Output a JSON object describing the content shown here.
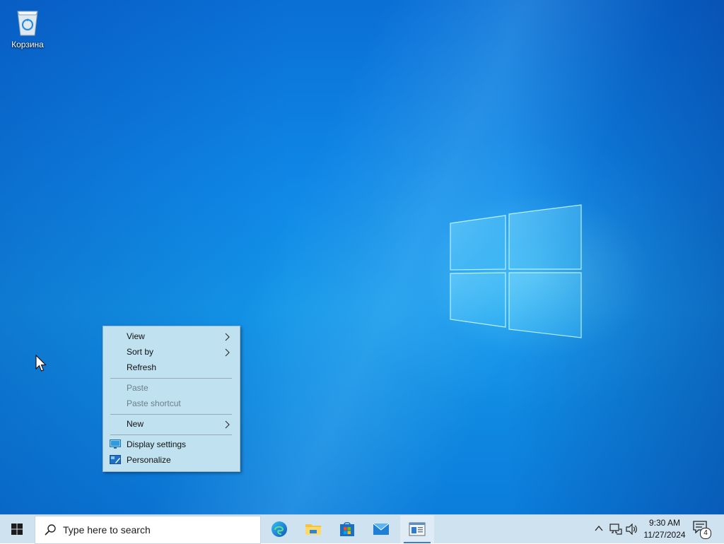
{
  "desktop": {
    "icons": [
      {
        "label": "Корзина",
        "icon": "recycle-bin-icon"
      }
    ]
  },
  "context_menu": {
    "items": [
      {
        "label": "View",
        "submenu": true,
        "enabled": true
      },
      {
        "label": "Sort by",
        "submenu": true,
        "enabled": true
      },
      {
        "label": "Refresh",
        "submenu": false,
        "enabled": true
      },
      {
        "label": "Paste",
        "submenu": false,
        "enabled": false
      },
      {
        "label": "Paste shortcut",
        "submenu": false,
        "enabled": false
      },
      {
        "label": "New",
        "submenu": true,
        "enabled": true
      },
      {
        "label": "Display settings",
        "icon": "display-settings-icon",
        "enabled": true
      },
      {
        "label": "Personalize",
        "icon": "personalize-icon",
        "enabled": true
      }
    ]
  },
  "taskbar": {
    "search_placeholder": "Type here to search",
    "pinned_apps": [
      "edge-icon",
      "file-explorer-icon",
      "microsoft-store-icon",
      "mail-icon",
      "notepad-app-icon"
    ],
    "tray_icons": [
      "chevron-up-icon",
      "network-icon",
      "volume-icon"
    ],
    "clock": {
      "time": "9:30 AM",
      "date": "11/27/2024"
    },
    "notification_count": "4"
  },
  "colors": {
    "desktop_background": "#0f87e6",
    "taskbar_background": "#cfe2f0",
    "context_menu_background": "#bfe1f0"
  }
}
